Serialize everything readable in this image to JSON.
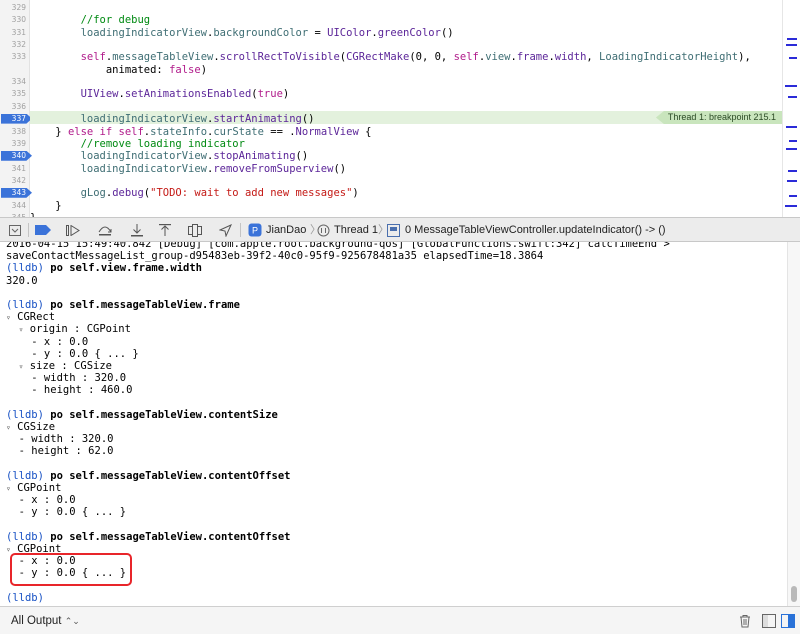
{
  "editor": {
    "lines": [
      {
        "num": "329",
        "segments": []
      },
      {
        "num": "330",
        "segments": [
          {
            "t": "        //for debug",
            "c": "t-comment"
          }
        ]
      },
      {
        "num": "331",
        "segments": [
          {
            "t": "        loadingIndicatorView",
            "c": "t-type"
          },
          {
            "t": ".",
            "c": "t-plain"
          },
          {
            "t": "backgroundColor",
            "c": "t-type"
          },
          {
            "t": " = ",
            "c": "t-plain"
          },
          {
            "t": "UIColor",
            "c": "t-fn"
          },
          {
            "t": ".",
            "c": "t-plain"
          },
          {
            "t": "greenColor",
            "c": "t-fn"
          },
          {
            "t": "()",
            "c": "t-plain"
          }
        ]
      },
      {
        "num": "332",
        "segments": []
      },
      {
        "num": "333",
        "segments": [
          {
            "t": "        self",
            "c": "t-kw"
          },
          {
            "t": ".",
            "c": "t-plain"
          },
          {
            "t": "messageTableView",
            "c": "t-type"
          },
          {
            "t": ".",
            "c": "t-plain"
          },
          {
            "t": "scrollRectToVisible",
            "c": "t-fn"
          },
          {
            "t": "(",
            "c": "t-plain"
          },
          {
            "t": "CGRectMake",
            "c": "t-fn"
          },
          {
            "t": "(0, 0, ",
            "c": "t-plain"
          },
          {
            "t": "self",
            "c": "t-kw"
          },
          {
            "t": ".",
            "c": "t-plain"
          },
          {
            "t": "view",
            "c": "t-type"
          },
          {
            "t": ".",
            "c": "t-plain"
          },
          {
            "t": "frame",
            "c": "t-fn"
          },
          {
            "t": ".",
            "c": "t-plain"
          },
          {
            "t": "width",
            "c": "t-fn"
          },
          {
            "t": ", ",
            "c": "t-plain"
          },
          {
            "t": "LoadingIndicatorHeight",
            "c": "t-type"
          },
          {
            "t": "),",
            "c": "t-plain"
          }
        ]
      },
      {
        "num": "",
        "segments": [
          {
            "t": "            animated: ",
            "c": "t-plain"
          },
          {
            "t": "false",
            "c": "t-kw"
          },
          {
            "t": ")",
            "c": "t-plain"
          }
        ]
      },
      {
        "num": "334",
        "segments": []
      },
      {
        "num": "335",
        "segments": [
          {
            "t": "        UIView",
            "c": "t-fn"
          },
          {
            "t": ".",
            "c": "t-plain"
          },
          {
            "t": "setAnimationsEnabled",
            "c": "t-fn"
          },
          {
            "t": "(",
            "c": "t-plain"
          },
          {
            "t": "true",
            "c": "t-kw"
          },
          {
            "t": ")",
            "c": "t-plain"
          }
        ]
      },
      {
        "num": "336",
        "segments": []
      },
      {
        "num": "337",
        "segments": [
          {
            "t": "        loadingIndicatorView",
            "c": "t-type"
          },
          {
            "t": ".",
            "c": "t-plain"
          },
          {
            "t": "startAnimating",
            "c": "t-fn"
          },
          {
            "t": "()",
            "c": "t-plain"
          }
        ]
      },
      {
        "num": "338",
        "segments": [
          {
            "t": "    } ",
            "c": "t-plain"
          },
          {
            "t": "else if self",
            "c": "t-kw"
          },
          {
            "t": ".",
            "c": "t-plain"
          },
          {
            "t": "stateInfo",
            "c": "t-type"
          },
          {
            "t": ".",
            "c": "t-plain"
          },
          {
            "t": "curState",
            "c": "t-type"
          },
          {
            "t": " == .",
            "c": "t-plain"
          },
          {
            "t": "NormalView",
            "c": "t-fn"
          },
          {
            "t": " {",
            "c": "t-plain"
          }
        ]
      },
      {
        "num": "339",
        "segments": [
          {
            "t": "        //remove loading indicator",
            "c": "t-comment"
          }
        ]
      },
      {
        "num": "340",
        "segments": [
          {
            "t": "        loadingIndicatorView",
            "c": "t-type"
          },
          {
            "t": ".",
            "c": "t-plain"
          },
          {
            "t": "stopAnimating",
            "c": "t-fn"
          },
          {
            "t": "()",
            "c": "t-plain"
          }
        ]
      },
      {
        "num": "341",
        "segments": [
          {
            "t": "        loadingIndicatorView",
            "c": "t-type"
          },
          {
            "t": ".",
            "c": "t-plain"
          },
          {
            "t": "removeFromSuperview",
            "c": "t-fn"
          },
          {
            "t": "()",
            "c": "t-plain"
          }
        ]
      },
      {
        "num": "342",
        "segments": []
      },
      {
        "num": "343",
        "segments": [
          {
            "t": "        gLog",
            "c": "t-type"
          },
          {
            "t": ".",
            "c": "t-plain"
          },
          {
            "t": "debug",
            "c": "t-fn"
          },
          {
            "t": "(",
            "c": "t-plain"
          },
          {
            "t": "\"TODO: wait to add new messages\"",
            "c": "t-str"
          },
          {
            "t": ")",
            "c": "t-plain"
          }
        ]
      },
      {
        "num": "344",
        "segments": [
          {
            "t": "    }",
            "c": "t-plain"
          }
        ]
      },
      {
        "num": "345",
        "segments": [
          {
            "t": "}",
            "c": "t-plain"
          }
        ]
      }
    ],
    "breakpoint_lines": [
      "337",
      "340",
      "343"
    ],
    "current_line": "337",
    "breakpoint_tag": "Thread 1: breakpoint 215.1",
    "colors": {
      "breakpoint": "#3b73d9",
      "current_line_bg": "#e3f1dd",
      "comment": "#008a12",
      "keyword": "#b01a8a",
      "string": "#c41a16"
    }
  },
  "debug_bar": {
    "buttons": [
      "hide-debug-area-icon",
      "breakpoints-toggle-icon",
      "continue-icon",
      "step-over-icon",
      "step-into-icon",
      "step-out-icon",
      "view-hierarchy-icon",
      "memory-graph-icon",
      "simulate-location-icon"
    ],
    "app_name": "JianDao",
    "thread": "Thread 1",
    "frame": "0 MessageTableViewController.updateIndicator() -> ()"
  },
  "console": {
    "lines": [
      {
        "kind": "out",
        "text": "2016-04-15 15:49:40.842 [Debug] [com.apple.root.background-qos] [GlobalFunctions.swift:342] calcTimeEnd >"
      },
      {
        "kind": "out",
        "text": "saveContactMessageList_group-d95483eb-39f2-40c0-95f9-925678481a35 elapsedTime=18.3864"
      },
      {
        "kind": "cmd",
        "prompt": "(lldb)",
        "text": " po self.view.frame.width"
      },
      {
        "kind": "out",
        "text": "320.0"
      },
      {
        "kind": "blank",
        "text": ""
      },
      {
        "kind": "cmd",
        "prompt": "(lldb)",
        "text": " po self.messageTableView.frame"
      },
      {
        "kind": "tree",
        "tri": "▿",
        "text": " CGRect"
      },
      {
        "kind": "tree",
        "tri": "▿",
        "text": " origin : CGPoint",
        "indent": "  "
      },
      {
        "kind": "out",
        "text": "    - x : 0.0"
      },
      {
        "kind": "out",
        "text": "    - y : 0.0 { ... }"
      },
      {
        "kind": "tree",
        "tri": "▿",
        "text": " size : CGSize",
        "indent": "  "
      },
      {
        "kind": "out",
        "text": "    - width : 320.0"
      },
      {
        "kind": "out",
        "text": "    - height : 460.0"
      },
      {
        "kind": "blank",
        "text": ""
      },
      {
        "kind": "cmd",
        "prompt": "(lldb)",
        "text": " po self.messageTableView.contentSize"
      },
      {
        "kind": "tree",
        "tri": "▿",
        "text": " CGSize"
      },
      {
        "kind": "out",
        "text": "  - width : 320.0"
      },
      {
        "kind": "out",
        "text": "  - height : 62.0"
      },
      {
        "kind": "blank",
        "text": ""
      },
      {
        "kind": "cmd",
        "prompt": "(lldb)",
        "text": " po self.messageTableView.contentOffset"
      },
      {
        "kind": "tree",
        "tri": "▿",
        "text": " CGPoint"
      },
      {
        "kind": "out",
        "text": "  - x : 0.0"
      },
      {
        "kind": "out",
        "text": "  - y : 0.0 { ... }"
      },
      {
        "kind": "blank",
        "text": ""
      },
      {
        "kind": "cmd",
        "prompt": "(lldb)",
        "text": " po self.messageTableView.contentOffset"
      },
      {
        "kind": "tree",
        "tri": "▿",
        "text": " CGPoint"
      },
      {
        "kind": "out",
        "text": "  - x : 0.0"
      },
      {
        "kind": "out",
        "text": "  - y : 0.0 { ... }"
      },
      {
        "kind": "blank",
        "text": ""
      },
      {
        "kind": "prompt",
        "prompt": "(lldb)",
        "text": ""
      }
    ],
    "highlight_color": "#e8252a"
  },
  "bottom_bar": {
    "output_filter": "All Output",
    "buttons": [
      "trash-icon",
      "split-left-icon",
      "split-right-icon"
    ]
  }
}
